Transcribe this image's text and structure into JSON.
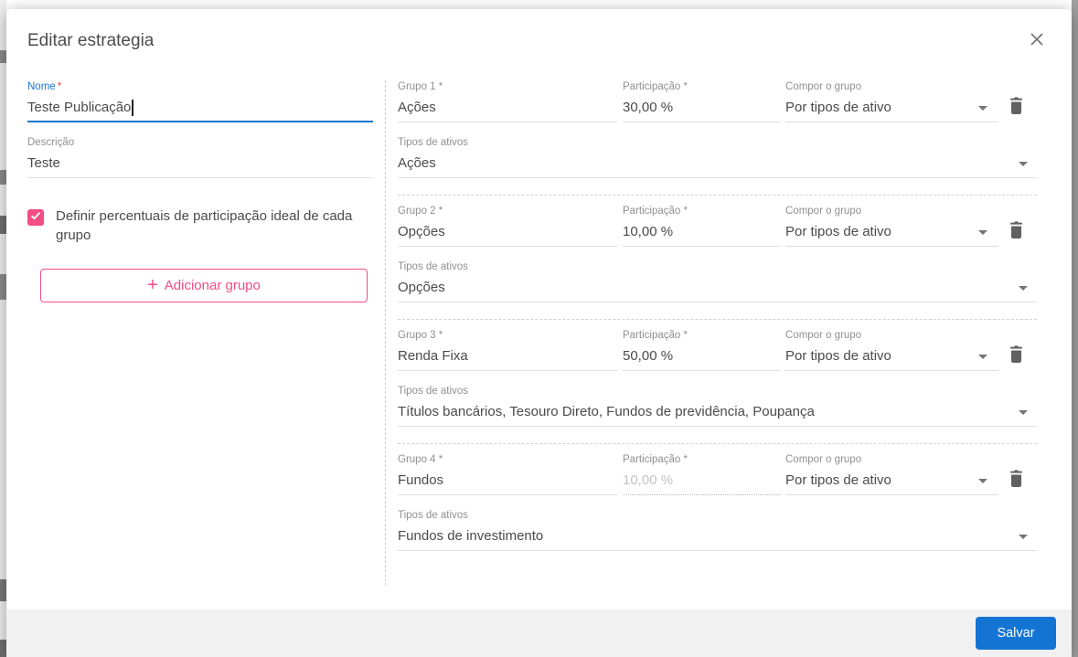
{
  "colors": {
    "accent_blue": "#1976d2",
    "accent_pink": "#f24d85",
    "save_blue": "#1474d4"
  },
  "dialog": {
    "title": "Editar estrategia"
  },
  "form": {
    "name_field": {
      "label": "Nome",
      "required_marker": "*",
      "value": "Teste Publicação"
    },
    "description_field": {
      "label": "Descrição",
      "value": "Teste"
    },
    "define_percentages_checkbox": {
      "label": "Definir percentuais de participação ideal de cada grupo",
      "checked": true
    },
    "add_group_button": {
      "plus": "+",
      "label": "Adicionar grupo"
    }
  },
  "groups": [
    {
      "group_label": "Grupo 1 *",
      "group_name": "Ações",
      "participation_label": "Participação *",
      "participation": "30,00 %",
      "participation_disabled": false,
      "compose_label": "Compor o grupo",
      "compose_value": "Por tipos de ativo",
      "asset_types_label": "Tipos de ativos",
      "asset_types_value": "Ações"
    },
    {
      "group_label": "Grupo 2 *",
      "group_name": "Opções",
      "participation_label": "Participação *",
      "participation": "10,00 %",
      "participation_disabled": false,
      "compose_label": "Compor o grupo",
      "compose_value": "Por tipos de ativo",
      "asset_types_label": "Tipos de ativos",
      "asset_types_value": "Opções"
    },
    {
      "group_label": "Grupo 3 *",
      "group_name": "Renda Fixa",
      "participation_label": "Participação *",
      "participation": "50,00 %",
      "participation_disabled": false,
      "compose_label": "Compor o grupo",
      "compose_value": "Por tipos de ativo",
      "asset_types_label": "Tipos de ativos",
      "asset_types_value": "Títulos bancários, Tesouro Direto, Fundos de previdência, Poupança"
    },
    {
      "group_label": "Grupo 4 *",
      "group_name": "Fundos",
      "participation_label": "Participação *",
      "participation": "10,00 %",
      "participation_disabled": true,
      "compose_label": "Compor o grupo",
      "compose_value": "Por tipos de ativo",
      "asset_types_label": "Tipos de ativos",
      "asset_types_value": "Fundos de investimento"
    }
  ],
  "footer": {
    "save_button": "Salvar"
  }
}
